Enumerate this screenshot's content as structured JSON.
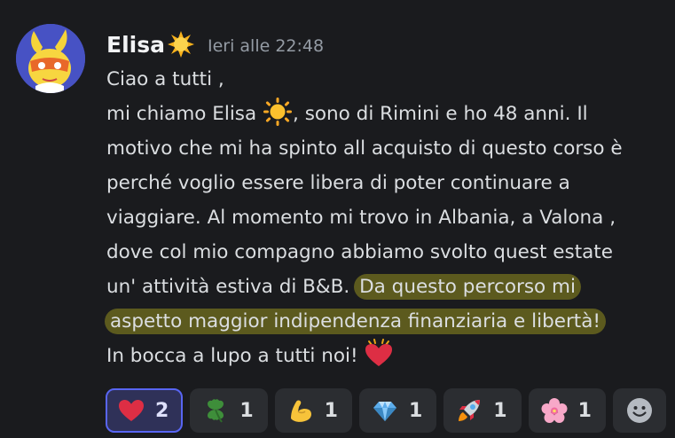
{
  "message": {
    "author": "Elisa",
    "author_emoji": "sun-emoji",
    "timestamp": "Ieri alle 22:48",
    "lines": {
      "l1": "Ciao a tutti ,",
      "l2a": "mi chiamo Elisa ",
      "l2b": ", sono di Rimini e ho 48 anni. Il",
      "l3": "motivo che mi ha spinto all acquisto di questo corso è",
      "l4": "perché voglio essere libera di poter continuare a",
      "l5": "viaggiare. Al momento mi trovo in Albania, a Valona ,",
      "l6": "dove col mio compagno abbiamo svolto quest estate",
      "l7a": "un' attività estiva di B&B. ",
      "l7b": "Da questo percorso mi",
      "l8": "aspetto maggior indipendenza finanziaria e libertà!",
      "l9": "In bocca a lupo a tutti noi! "
    },
    "highlight_color": "#5c5a1e"
  },
  "reactions": [
    {
      "emoji": "heart-emoji",
      "count": "2",
      "active": true
    },
    {
      "emoji": "four-leaf-clover-emoji",
      "count": "1"
    },
    {
      "emoji": "flexed-biceps-emoji",
      "count": "1"
    },
    {
      "emoji": "gem-emoji",
      "count": "1"
    },
    {
      "emoji": "rocket-emoji",
      "count": "1"
    },
    {
      "emoji": "cherry-blossom-emoji",
      "count": "1"
    }
  ],
  "colors": {
    "background": "#1a1b1e",
    "text": "#dbdee1",
    "muted": "#949ba4",
    "accent": "#5865f2"
  }
}
